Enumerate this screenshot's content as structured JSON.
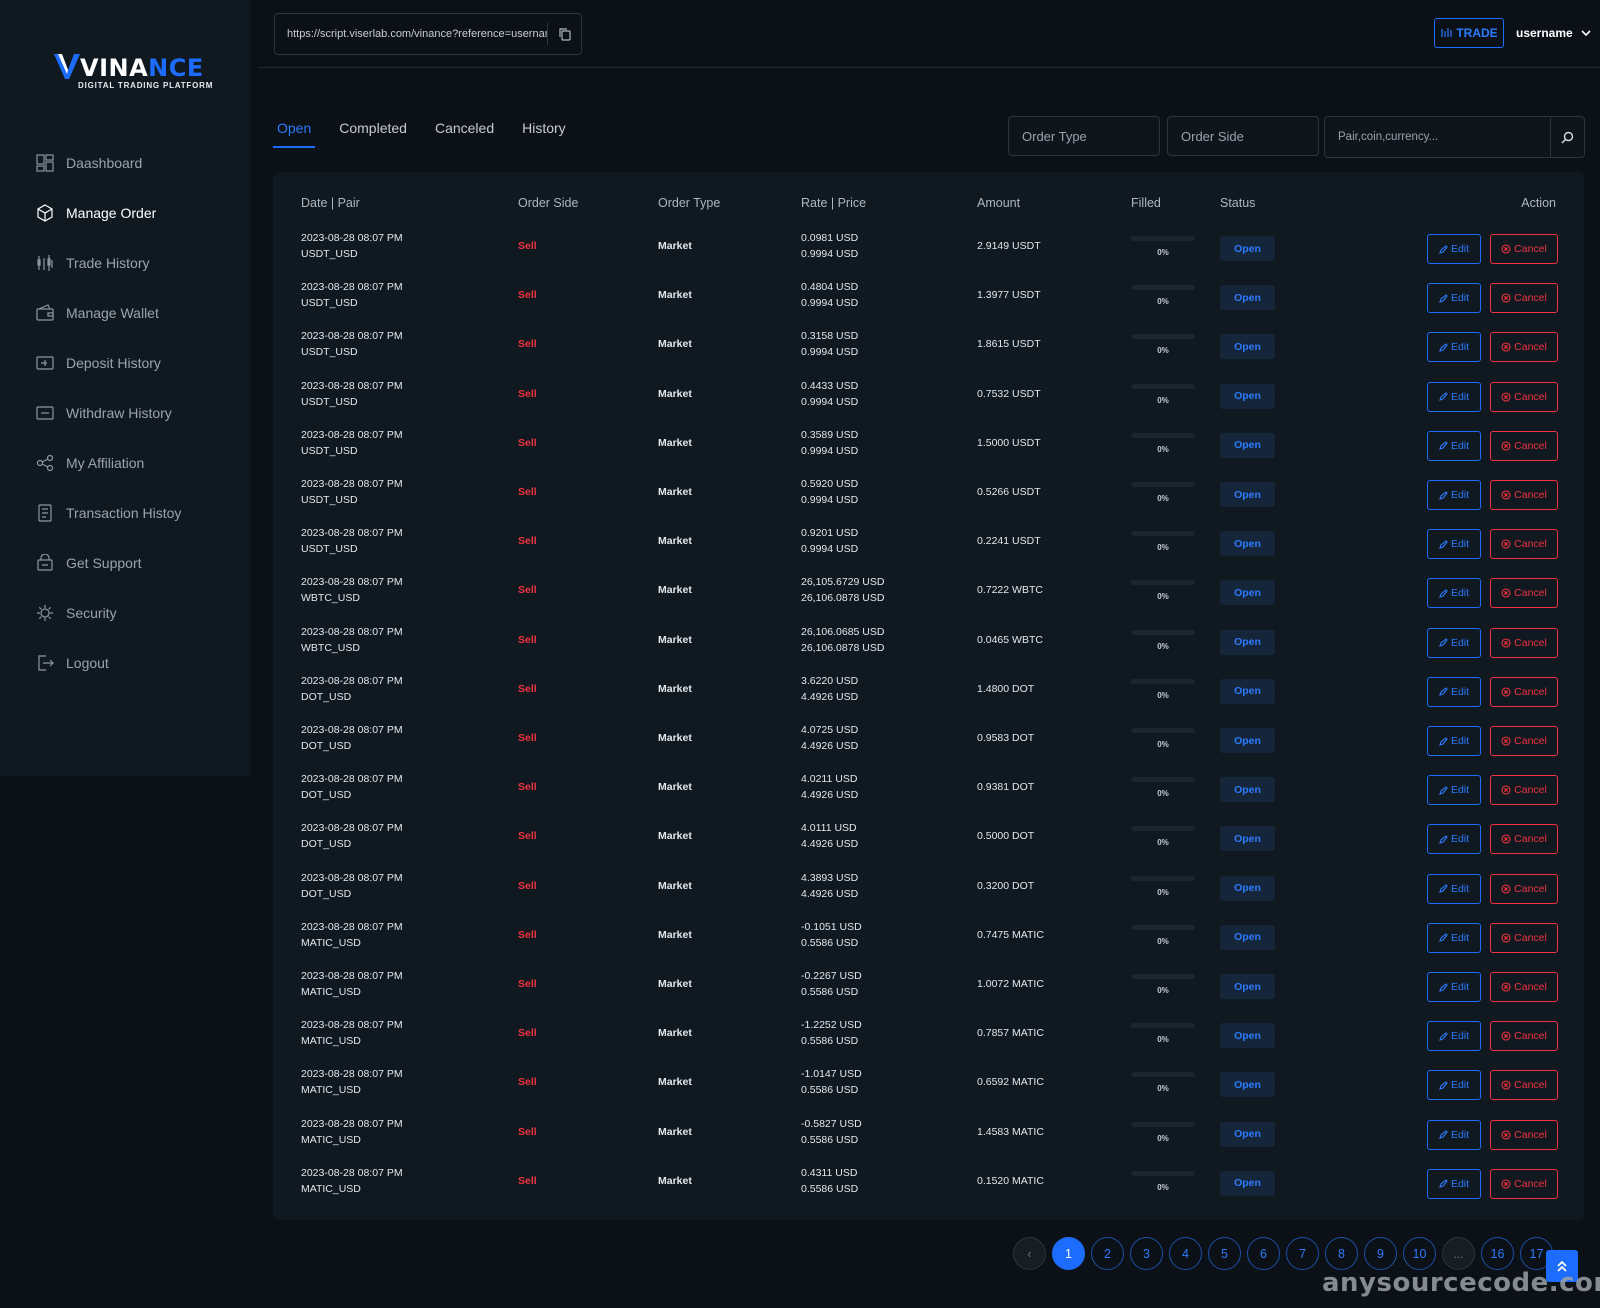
{
  "brand": {
    "logo_main": "VINA",
    "logo_accent": "NCE",
    "logo_sub": "DIGITAL TRADING PLATFORM"
  },
  "sidebar": {
    "items": [
      {
        "label": "Daashboard",
        "icon": "dashboard-icon",
        "active": false
      },
      {
        "label": "Manage Order",
        "icon": "box-icon",
        "active": true
      },
      {
        "label": "Trade History",
        "icon": "candlestick-icon",
        "active": false
      },
      {
        "label": "Manage Wallet",
        "icon": "wallet-icon",
        "active": false
      },
      {
        "label": "Deposit History",
        "icon": "deposit-icon",
        "active": false
      },
      {
        "label": "Withdraw History",
        "icon": "withdraw-icon",
        "active": false
      },
      {
        "label": "My Affiliation",
        "icon": "affiliate-icon",
        "active": false
      },
      {
        "label": "Transaction Histoy",
        "icon": "transaction-icon",
        "active": false
      },
      {
        "label": "Get Support",
        "icon": "support-icon",
        "active": false
      },
      {
        "label": "Security",
        "icon": "security-icon",
        "active": false
      },
      {
        "label": "Logout",
        "icon": "logout-icon",
        "active": false
      }
    ]
  },
  "header": {
    "referral_url": "https://script.viserlab.com/vinance?reference=username",
    "trade_label": "TRADE",
    "username": "username"
  },
  "tabs": [
    {
      "label": "Open",
      "active": true
    },
    {
      "label": "Completed",
      "active": false
    },
    {
      "label": "Canceled",
      "active": false
    },
    {
      "label": "History",
      "active": false
    }
  ],
  "filters": {
    "order_type_placeholder": "Order Type",
    "order_side_placeholder": "Order Side",
    "search_placeholder": "Pair,coin,currency..."
  },
  "table": {
    "columns": [
      "Date | Pair",
      "Order Side",
      "Order Type",
      "Rate | Price",
      "Amount",
      "Filled",
      "Status",
      "Action"
    ],
    "edit_label": "Edit",
    "cancel_label": "Cancel",
    "rows": [
      {
        "date": "2023-08-28 08:07 PM",
        "pair": "USDT_USD",
        "side": "Sell",
        "type": "Market",
        "rate": "0.0981 USD",
        "price": "0.9994 USD",
        "amount": "2.9149 USDT",
        "filled": 0,
        "filled_label": "0%",
        "status": "Open"
      },
      {
        "date": "2023-08-28 08:07 PM",
        "pair": "USDT_USD",
        "side": "Sell",
        "type": "Market",
        "rate": "0.4804 USD",
        "price": "0.9994 USD",
        "amount": "1.3977 USDT",
        "filled": 0,
        "filled_label": "0%",
        "status": "Open"
      },
      {
        "date": "2023-08-28 08:07 PM",
        "pair": "USDT_USD",
        "side": "Sell",
        "type": "Market",
        "rate": "0.3158 USD",
        "price": "0.9994 USD",
        "amount": "1.8615 USDT",
        "filled": 0,
        "filled_label": "0%",
        "status": "Open"
      },
      {
        "date": "2023-08-28 08:07 PM",
        "pair": "USDT_USD",
        "side": "Sell",
        "type": "Market",
        "rate": "0.4433 USD",
        "price": "0.9994 USD",
        "amount": "0.7532 USDT",
        "filled": 0,
        "filled_label": "0%",
        "status": "Open"
      },
      {
        "date": "2023-08-28 08:07 PM",
        "pair": "USDT_USD",
        "side": "Sell",
        "type": "Market",
        "rate": "0.3589 USD",
        "price": "0.9994 USD",
        "amount": "1.5000 USDT",
        "filled": 0,
        "filled_label": "0%",
        "status": "Open"
      },
      {
        "date": "2023-08-28 08:07 PM",
        "pair": "USDT_USD",
        "side": "Sell",
        "type": "Market",
        "rate": "0.5920 USD",
        "price": "0.9994 USD",
        "amount": "0.5266 USDT",
        "filled": 0,
        "filled_label": "0%",
        "status": "Open"
      },
      {
        "date": "2023-08-28 08:07 PM",
        "pair": "USDT_USD",
        "side": "Sell",
        "type": "Market",
        "rate": "0.9201 USD",
        "price": "0.9994 USD",
        "amount": "0.2241 USDT",
        "filled": 0,
        "filled_label": "0%",
        "status": "Open"
      },
      {
        "date": "2023-08-28 08:07 PM",
        "pair": "WBTC_USD",
        "side": "Sell",
        "type": "Market",
        "rate": "26,105.6729 USD",
        "price": "26,106.0878 USD",
        "amount": "0.7222 WBTC",
        "filled": 0,
        "filled_label": "0%",
        "status": "Open"
      },
      {
        "date": "2023-08-28 08:07 PM",
        "pair": "WBTC_USD",
        "side": "Sell",
        "type": "Market",
        "rate": "26,106.0685 USD",
        "price": "26,106.0878 USD",
        "amount": "0.0465 WBTC",
        "filled": 0,
        "filled_label": "0%",
        "status": "Open"
      },
      {
        "date": "2023-08-28 08:07 PM",
        "pair": "DOT_USD",
        "side": "Sell",
        "type": "Market",
        "rate": "3.6220 USD",
        "price": "4.4926 USD",
        "amount": "1.4800 DOT",
        "filled": 0,
        "filled_label": "0%",
        "status": "Open"
      },
      {
        "date": "2023-08-28 08:07 PM",
        "pair": "DOT_USD",
        "side": "Sell",
        "type": "Market",
        "rate": "4.0725 USD",
        "price": "4.4926 USD",
        "amount": "0.9583 DOT",
        "filled": 0,
        "filled_label": "0%",
        "status": "Open"
      },
      {
        "date": "2023-08-28 08:07 PM",
        "pair": "DOT_USD",
        "side": "Sell",
        "type": "Market",
        "rate": "4.0211 USD",
        "price": "4.4926 USD",
        "amount": "0.9381 DOT",
        "filled": 0,
        "filled_label": "0%",
        "status": "Open"
      },
      {
        "date": "2023-08-28 08:07 PM",
        "pair": "DOT_USD",
        "side": "Sell",
        "type": "Market",
        "rate": "4.0111 USD",
        "price": "4.4926 USD",
        "amount": "0.5000 DOT",
        "filled": 0,
        "filled_label": "0%",
        "status": "Open"
      },
      {
        "date": "2023-08-28 08:07 PM",
        "pair": "DOT_USD",
        "side": "Sell",
        "type": "Market",
        "rate": "4.3893 USD",
        "price": "4.4926 USD",
        "amount": "0.3200 DOT",
        "filled": 0,
        "filled_label": "0%",
        "status": "Open"
      },
      {
        "date": "2023-08-28 08:07 PM",
        "pair": "MATIC_USD",
        "side": "Sell",
        "type": "Market",
        "rate": "-0.1051 USD",
        "price": "0.5586 USD",
        "amount": "0.7475 MATIC",
        "filled": 0,
        "filled_label": "0%",
        "status": "Open"
      },
      {
        "date": "2023-08-28 08:07 PM",
        "pair": "MATIC_USD",
        "side": "Sell",
        "type": "Market",
        "rate": "-0.2267 USD",
        "price": "0.5586 USD",
        "amount": "1.0072 MATIC",
        "filled": 0,
        "filled_label": "0%",
        "status": "Open"
      },
      {
        "date": "2023-08-28 08:07 PM",
        "pair": "MATIC_USD",
        "side": "Sell",
        "type": "Market",
        "rate": "-1.2252 USD",
        "price": "0.5586 USD",
        "amount": "0.7857 MATIC",
        "filled": 0,
        "filled_label": "0%",
        "status": "Open"
      },
      {
        "date": "2023-08-28 08:07 PM",
        "pair": "MATIC_USD",
        "side": "Sell",
        "type": "Market",
        "rate": "-1.0147 USD",
        "price": "0.5586 USD",
        "amount": "0.6592 MATIC",
        "filled": 0,
        "filled_label": "0%",
        "status": "Open"
      },
      {
        "date": "2023-08-28 08:07 PM",
        "pair": "MATIC_USD",
        "side": "Sell",
        "type": "Market",
        "rate": "-0.5827 USD",
        "price": "0.5586 USD",
        "amount": "1.4583 MATIC",
        "filled": 0,
        "filled_label": "0%",
        "status": "Open"
      },
      {
        "date": "2023-08-28 08:07 PM",
        "pair": "MATIC_USD",
        "side": "Sell",
        "type": "Market",
        "rate": "0.4311 USD",
        "price": "0.5586 USD",
        "amount": "0.1520 MATIC",
        "filled": 0,
        "filled_label": "0%",
        "status": "Open"
      }
    ]
  },
  "pagination": {
    "prev_label": "‹",
    "pages": [
      "1",
      "2",
      "3",
      "4",
      "5",
      "6",
      "7",
      "8",
      "9",
      "10",
      "...",
      "16",
      "17"
    ],
    "current": "1"
  },
  "watermark": "anysourcecode.com",
  "colors": {
    "accent": "#1b6cff",
    "sell": "#ef3340",
    "bg": "#0b1116",
    "panel": "#111920"
  }
}
